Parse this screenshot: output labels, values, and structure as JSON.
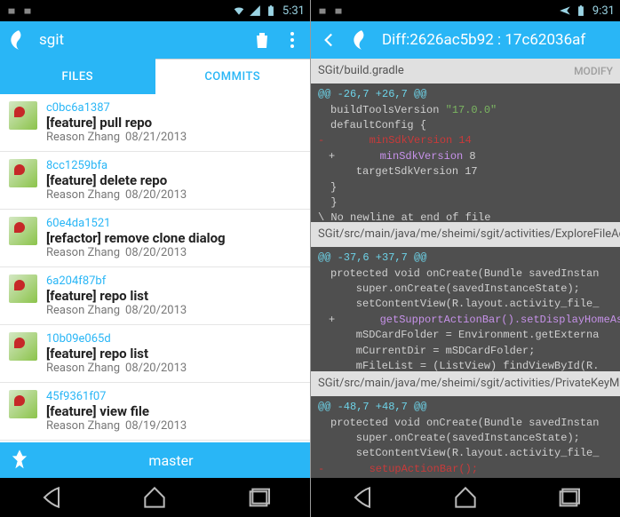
{
  "left": {
    "status": {
      "time": "5:31"
    },
    "appbar": {
      "title": "sgit"
    },
    "tabs": {
      "files": "FILES",
      "commits": "COMMITS"
    },
    "commits": [
      {
        "hash": "c0bc6a1387",
        "msg": "[feature] pull repo",
        "author": "Reason Zhang",
        "date": "08/21/2013"
      },
      {
        "hash": "8cc1259bfa",
        "msg": "[feature] delete repo",
        "author": "Reason Zhang",
        "date": "08/20/2013"
      },
      {
        "hash": "60e4da1521",
        "msg": "[refactor] remove clone dialog",
        "author": "Reason Zhang",
        "date": "08/20/2013"
      },
      {
        "hash": "6a204f87bf",
        "msg": "[feature] repo list",
        "author": "Reason Zhang",
        "date": "08/20/2013"
      },
      {
        "hash": "10b09e065d",
        "msg": "[feature] repo list",
        "author": "Reason Zhang",
        "date": "08/20/2013"
      },
      {
        "hash": "45f9361f07",
        "msg": "[feature] view file",
        "author": "Reason Zhang",
        "date": "08/19/2013"
      }
    ],
    "branch": "master"
  },
  "right": {
    "status": {
      "time": "9:31"
    },
    "appbar": {
      "title": "Diff:2626ac5b92 : 17c62036af"
    },
    "modify_label": "MODIFY",
    "files": [
      {
        "path": "SGit/build.gradle",
        "hunks": [
          {
            "header": "@@ -26,7 +26,7 @@",
            "lines": [
              {
                "cls": "ctx",
                "html": "buildToolsVersion <span class='str'>\"17.0.0\"</span>"
              },
              {
                "cls": "ctx",
                "html": ""
              },
              {
                "cls": "ctx",
                "html": "defaultConfig {"
              },
              {
                "cls": "del",
                "html": "-       minSdkVersion 14"
              },
              {
                "cls": "add",
                "html": "+       <span class='kw'>minSdkVersion</span> 8"
              },
              {
                "cls": "ctx",
                "html": "    targetSdkVersion 17"
              },
              {
                "cls": "ctx",
                "html": "}"
              },
              {
                "cls": "plain",
                "html": "  }"
              },
              {
                "cls": "plain",
                "html": "\\ No newline at end of file"
              }
            ]
          }
        ]
      },
      {
        "path": "SGit/src/main/java/me/sheimi/sgit/activities/ExploreFileActivity.java",
        "hunks": [
          {
            "header": "@@ -37,6 +37,7 @@",
            "lines": [
              {
                "cls": "ctx",
                "html": "protected void onCreate(Bundle savedInstan"
              },
              {
                "cls": "ctx",
                "html": "    super.onCreate(savedInstanceState);"
              },
              {
                "cls": "ctx",
                "html": "    setContentView(R.layout.activity_file_"
              },
              {
                "cls": "add",
                "html": "+       <span class='kw'>getSupportActionBar().setDisplayHomeAs</span>"
              },
              {
                "cls": "ctx",
                "html": "    mSDCardFolder = Environment.getExterna"
              },
              {
                "cls": "ctx",
                "html": "    mCurrentDir = mSDCardFolder;"
              },
              {
                "cls": "ctx",
                "html": "    mFileList = (ListView) findViewById(R."
              }
            ]
          }
        ]
      },
      {
        "path": "SGit/src/main/java/me/sheimi/sgit/activities/PrivateKeyManageActivity.java",
        "hunks": [
          {
            "header": "@@ -48,7 +48,7 @@",
            "lines": [
              {
                "cls": "ctx",
                "html": "protected void onCreate(Bundle savedInstan"
              },
              {
                "cls": "ctx",
                "html": "    super.onCreate(savedInstanceState);"
              },
              {
                "cls": "ctx",
                "html": "    setContentView(R.layout.activity_file_"
              },
              {
                "cls": "del",
                "html": "-       setupActionBar();"
              }
            ]
          }
        ]
      }
    ]
  }
}
